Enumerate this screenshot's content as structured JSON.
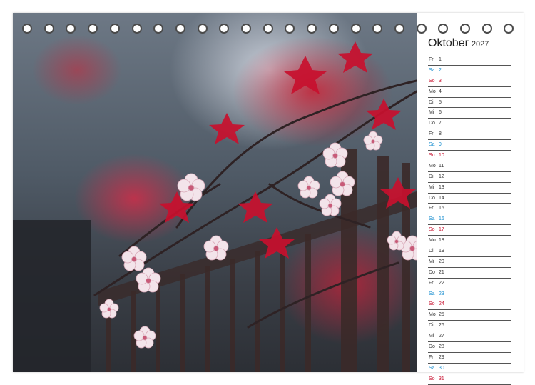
{
  "calendar": {
    "month": "Oktober",
    "year": "2027",
    "days": [
      {
        "dow": "Fr",
        "day": "1",
        "kind": "weekday"
      },
      {
        "dow": "Sa",
        "day": "2",
        "kind": "saturday"
      },
      {
        "dow": "So",
        "day": "3",
        "kind": "sunday"
      },
      {
        "dow": "Mo",
        "day": "4",
        "kind": "weekday"
      },
      {
        "dow": "Di",
        "day": "5",
        "kind": "weekday"
      },
      {
        "dow": "Mi",
        "day": "6",
        "kind": "weekday"
      },
      {
        "dow": "Do",
        "day": "7",
        "kind": "weekday"
      },
      {
        "dow": "Fr",
        "day": "8",
        "kind": "weekday"
      },
      {
        "dow": "Sa",
        "day": "9",
        "kind": "saturday"
      },
      {
        "dow": "So",
        "day": "10",
        "kind": "sunday"
      },
      {
        "dow": "Mo",
        "day": "11",
        "kind": "weekday"
      },
      {
        "dow": "Di",
        "day": "12",
        "kind": "weekday"
      },
      {
        "dow": "Mi",
        "day": "13",
        "kind": "weekday"
      },
      {
        "dow": "Do",
        "day": "14",
        "kind": "weekday"
      },
      {
        "dow": "Fr",
        "day": "15",
        "kind": "weekday"
      },
      {
        "dow": "Sa",
        "day": "16",
        "kind": "saturday"
      },
      {
        "dow": "So",
        "day": "17",
        "kind": "sunday"
      },
      {
        "dow": "Mo",
        "day": "18",
        "kind": "weekday"
      },
      {
        "dow": "Di",
        "day": "19",
        "kind": "weekday"
      },
      {
        "dow": "Mi",
        "day": "20",
        "kind": "weekday"
      },
      {
        "dow": "Do",
        "day": "21",
        "kind": "weekday"
      },
      {
        "dow": "Fr",
        "day": "22",
        "kind": "weekday"
      },
      {
        "dow": "Sa",
        "day": "23",
        "kind": "saturday"
      },
      {
        "dow": "So",
        "day": "24",
        "kind": "sunday"
      },
      {
        "dow": "Mo",
        "day": "25",
        "kind": "weekday"
      },
      {
        "dow": "Di",
        "day": "26",
        "kind": "weekday"
      },
      {
        "dow": "Mi",
        "day": "27",
        "kind": "weekday"
      },
      {
        "dow": "Do",
        "day": "28",
        "kind": "weekday"
      },
      {
        "dow": "Fr",
        "day": "29",
        "kind": "weekday"
      },
      {
        "dow": "Sa",
        "day": "30",
        "kind": "saturday"
      },
      {
        "dow": "So",
        "day": "31",
        "kind": "sunday"
      }
    ]
  },
  "colors": {
    "saturday": "#1a8fd0",
    "sunday": "#c8102e",
    "blossom_red": "#c8102e",
    "blossom_white": "#f3e4ea"
  },
  "photo": {
    "icon": "cherry-blossom-photo"
  },
  "binding": {
    "icon": "wire-binding-ring"
  }
}
